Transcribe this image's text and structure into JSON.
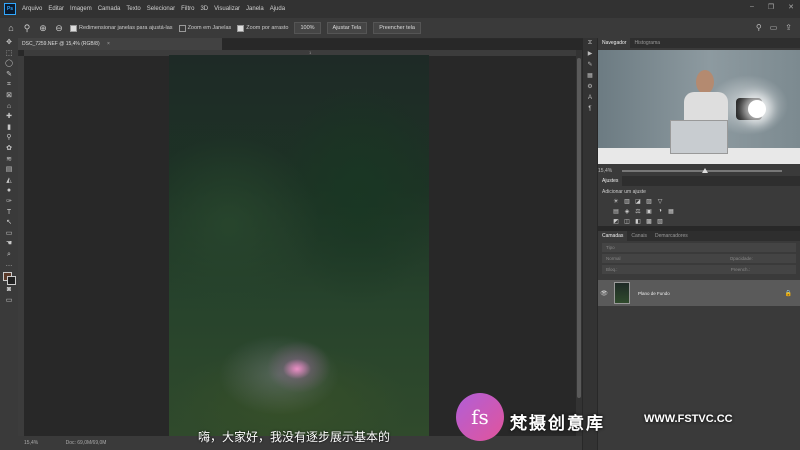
{
  "app": {
    "logo": "Ps"
  },
  "menu": [
    "Arquivo",
    "Editar",
    "Imagem",
    "Camada",
    "Texto",
    "Selecionar",
    "Filtro",
    "3D",
    "Visualizar",
    "Janela",
    "Ajuda"
  ],
  "window_controls": [
    "–",
    "❐",
    "✕"
  ],
  "options_bar": {
    "resize_windows": "Redimensionar janelas para ajustá-las",
    "zoom_all": "Zoom em Janelas",
    "scrubby_zoom": "Zoom por arrasto",
    "zoom_100": "100%",
    "fit_screen": "Ajustar Tela",
    "fill_screen": "Preencher tela"
  },
  "document": {
    "tab_title": "DSC_7259.NEF @ 15,4% (RGB/8)",
    "close": "×"
  },
  "ruler": {
    "mark": "1"
  },
  "status": {
    "zoom": "15,4%",
    "doc": "Doc: 69,0M/69,0M"
  },
  "navigator": {
    "tabs": [
      "Navegador",
      "Histograma"
    ],
    "zoom": "15,4%"
  },
  "adjustments": {
    "tab": "Ajustes",
    "title": "Adicionar um ajuste",
    "row1": [
      "☀",
      "▥",
      "◪",
      "▨",
      "▽"
    ],
    "row2": [
      "▤",
      "◈",
      "⚖",
      "▣",
      "◑",
      "▦"
    ],
    "row3": [
      "◩",
      "◫",
      "◧",
      "▩",
      "▧"
    ]
  },
  "layers": {
    "tabs": [
      "Camadas",
      "Canais",
      "Demarcadores"
    ],
    "search": "Tipo",
    "blend": "Normal",
    "opacity": "Opacidade:",
    "lock": "Bloq.:",
    "fill": "Preench.:",
    "layer_name": "Plano de Fundo"
  },
  "subtitle": "嗨，大家好，我没有逐步展示基本的",
  "watermark": {
    "logo": "fs",
    "name": "梵摄创意库",
    "url": "WWW.FSTVC.CC"
  },
  "tools": [
    "✥",
    "⬚",
    "◯",
    "✎",
    "⌗",
    "⊠",
    "⌂",
    "✚",
    "▮",
    "⚲",
    "✿",
    "≋",
    "▤",
    "◭",
    "●",
    "✑",
    "T",
    "↖",
    "▭",
    "☚",
    "⌕"
  ]
}
